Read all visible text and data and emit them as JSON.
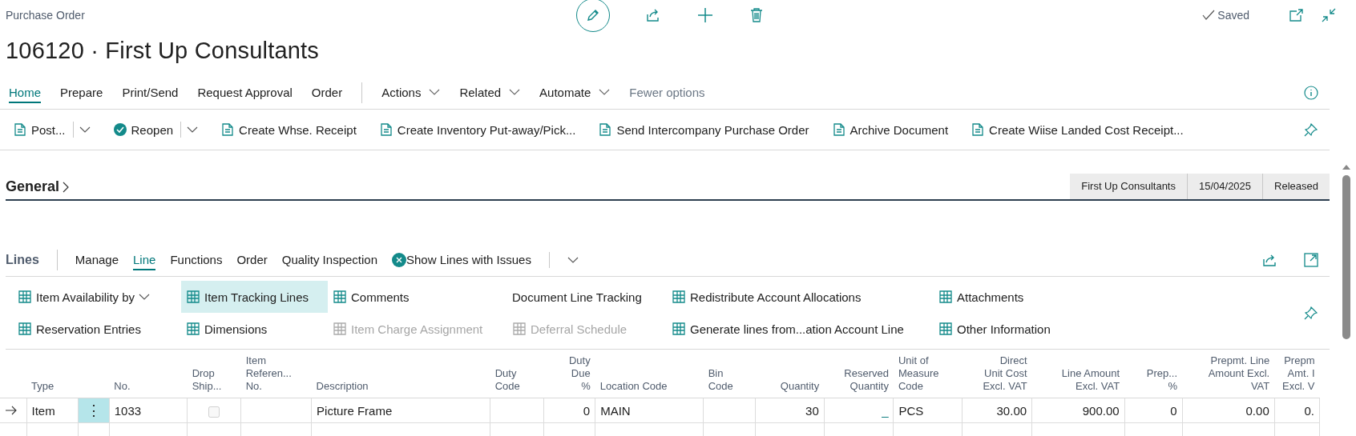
{
  "page": {
    "caption": "Purchase Order",
    "title": "106120 · First Up Consultants",
    "status": "Saved"
  },
  "menu": [
    {
      "label": "Home",
      "selected": true,
      "kind": "tab"
    },
    {
      "label": "Prepare",
      "selected": false,
      "kind": "tab"
    },
    {
      "label": "Print/Send",
      "selected": false,
      "kind": "tab"
    },
    {
      "label": "Request Approval",
      "selected": false,
      "kind": "tab"
    },
    {
      "label": "Order",
      "selected": false,
      "kind": "tab"
    },
    {
      "label": "Actions",
      "selected": false,
      "kind": "dropdown"
    },
    {
      "label": "Related",
      "selected": false,
      "kind": "dropdown"
    },
    {
      "label": "Automate",
      "selected": false,
      "kind": "dropdown"
    },
    {
      "label": "Fewer options",
      "selected": false,
      "kind": "link"
    }
  ],
  "actions": [
    {
      "label": "Post...",
      "split": true
    },
    {
      "label": "Reopen",
      "split": true
    },
    {
      "label": "Create Whse. Receipt",
      "split": false
    },
    {
      "label": "Create Inventory Put-away/Pick...",
      "split": false
    },
    {
      "label": "Send Intercompany Purchase Order",
      "split": false
    },
    {
      "label": "Archive Document",
      "split": false
    },
    {
      "label": "Create Wiise Landed Cost Receipt...",
      "split": false
    }
  ],
  "general": {
    "title": "General",
    "badges": [
      "First Up Consultants",
      "15/04/2025",
      "Released"
    ]
  },
  "lines": {
    "title": "Lines",
    "tabs": [
      {
        "label": "Manage",
        "selected": false
      },
      {
        "label": "Line",
        "selected": true
      },
      {
        "label": "Functions",
        "selected": false
      },
      {
        "label": "Order",
        "selected": false
      },
      {
        "label": "Quality Inspection",
        "selected": false
      }
    ],
    "filter": "Show Lines with Issues",
    "actions": [
      {
        "label": "Item Availability by",
        "selected": false,
        "disabled": false,
        "dropdown": true,
        "icon": true
      },
      {
        "label": "Item Tracking Lines",
        "selected": true,
        "disabled": false,
        "dropdown": false,
        "icon": true
      },
      {
        "label": "Comments",
        "selected": false,
        "disabled": false,
        "dropdown": false,
        "icon": true
      },
      {
        "label": "Document Line Tracking",
        "selected": false,
        "disabled": false,
        "dropdown": false,
        "icon": false
      },
      {
        "label": "Redistribute Account Allocations",
        "selected": false,
        "disabled": false,
        "dropdown": false,
        "icon": true
      },
      {
        "label": "Attachments",
        "selected": false,
        "disabled": false,
        "dropdown": false,
        "icon": true
      },
      {
        "label": "Reservation Entries",
        "selected": false,
        "disabled": false,
        "dropdown": false,
        "icon": true
      },
      {
        "label": "Dimensions",
        "selected": false,
        "disabled": false,
        "dropdown": false,
        "icon": true
      },
      {
        "label": "Item Charge Assignment",
        "selected": false,
        "disabled": true,
        "dropdown": false,
        "icon": true
      },
      {
        "label": "Deferral Schedule",
        "selected": false,
        "disabled": true,
        "dropdown": false,
        "icon": true
      },
      {
        "label": "Generate lines from...ation Account Line",
        "selected": false,
        "disabled": false,
        "dropdown": false,
        "icon": true
      },
      {
        "label": "Other Information",
        "selected": false,
        "disabled": false,
        "dropdown": false,
        "icon": true
      }
    ]
  },
  "table": {
    "columns": [
      {
        "label": "Type",
        "kind": "text"
      },
      {
        "kind": "menu"
      },
      {
        "label": "No.",
        "kind": "text"
      },
      {
        "label": "Drop\nShip...",
        "kind": "check"
      },
      {
        "label": "Item\nReferen...\nNo.",
        "kind": "text"
      },
      {
        "label": "Description",
        "kind": "text"
      },
      {
        "label": "Duty\nCode",
        "kind": "text"
      },
      {
        "label": "Duty\nDue\n%",
        "kind": "num"
      },
      {
        "label": "Location Code",
        "kind": "text"
      },
      {
        "label": "Bin\nCode",
        "kind": "text"
      },
      {
        "label": "Quantity",
        "kind": "num"
      },
      {
        "label": "Reserved\nQuantity",
        "kind": "link"
      },
      {
        "label": "Unit of\nMeasure\nCode",
        "kind": "text"
      },
      {
        "label": "Direct\nUnit Cost\nExcl. VAT",
        "kind": "num"
      },
      {
        "label": "Line Amount\nExcl. VAT",
        "kind": "num"
      },
      {
        "label": "Prep...\n%",
        "kind": "num"
      },
      {
        "label": "Prepmt. Line\nAmount Excl.\nVAT",
        "kind": "num"
      },
      {
        "label": "Prepm\nAmt. I\nExcl. V",
        "kind": "num"
      }
    ],
    "rows": [
      {
        "current": true,
        "cells": [
          "Item",
          "⋮",
          "1033",
          false,
          null,
          "Picture Frame",
          null,
          "0",
          "MAIN",
          null,
          "30",
          "_",
          "PCS",
          "30.00",
          "900.00",
          "0",
          "0.00",
          "0."
        ]
      }
    ]
  }
}
